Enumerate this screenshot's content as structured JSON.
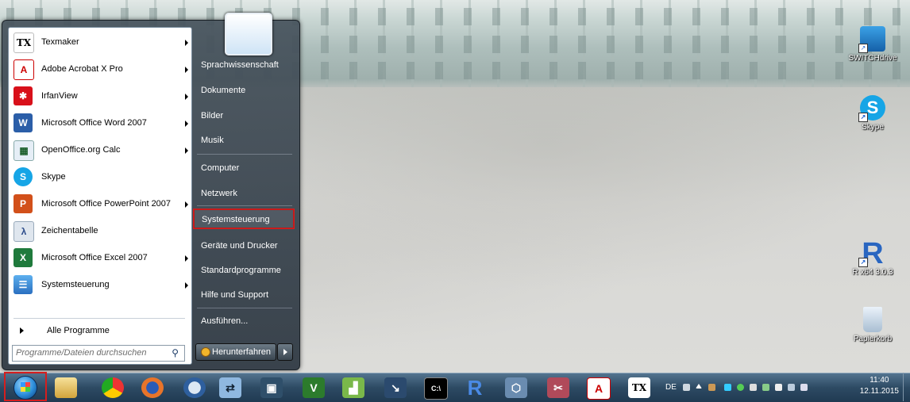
{
  "start_menu": {
    "programs": [
      {
        "label": "Texmaker",
        "icon": "texmaker-icon",
        "submenu": true
      },
      {
        "label": "Adobe Acrobat X Pro",
        "icon": "acrobat-icon",
        "submenu": true
      },
      {
        "label": "IrfanView",
        "icon": "irfanview-icon",
        "submenu": true
      },
      {
        "label": "Microsoft Office Word 2007",
        "icon": "word-icon",
        "submenu": true
      },
      {
        "label": "OpenOffice.org Calc",
        "icon": "calc-icon",
        "submenu": true
      },
      {
        "label": "Skype",
        "icon": "skype-icon",
        "submenu": false
      },
      {
        "label": "Microsoft Office PowerPoint 2007",
        "icon": "powerpoint-icon",
        "submenu": true
      },
      {
        "label": "Zeichentabelle",
        "icon": "charmap-icon",
        "submenu": false
      },
      {
        "label": "Microsoft Office Excel 2007",
        "icon": "excel-icon",
        "submenu": true
      },
      {
        "label": "Systemsteuerung",
        "icon": "control-panel-icon",
        "submenu": true
      }
    ],
    "all_programs": "Alle Programme",
    "search_placeholder": "Programme/Dateien durchsuchen",
    "right_links": [
      {
        "label": "Sprachwissenschaft"
      },
      {
        "label": "Dokumente"
      },
      {
        "label": "Bilder"
      },
      {
        "label": "Musik"
      },
      {
        "label": "Computer"
      },
      {
        "label": "Netzwerk"
      },
      {
        "label": "Systemsteuerung",
        "highlighted": true
      },
      {
        "label": "Geräte und Drucker"
      },
      {
        "label": "Standardprogramme"
      },
      {
        "label": "Hilfe und Support"
      },
      {
        "label": "Ausführen..."
      }
    ],
    "shutdown_label": "Herunterfahren"
  },
  "desktop_icons": [
    {
      "label": "SWITCHdrive",
      "icon": "switchdrive-icon"
    },
    {
      "label": "Skype",
      "icon": "skype-icon"
    },
    {
      "label": "R x64 3.0.3",
      "icon": "r-icon"
    },
    {
      "label": "Papierkorb",
      "icon": "recycle-bin-icon"
    }
  ],
  "taskbar": {
    "pinned": [
      "explorer-icon",
      "chrome-icon",
      "firefox-icon",
      "thunderbird-icon",
      "network-icon",
      "virtual-desktop-icon",
      "vim-icon",
      "chart-app-icon",
      "inkscape-icon",
      "terminal-icon",
      "r-icon",
      "virtualbox-icon",
      "tools-icon",
      "acrobat-icon",
      "texmaker-icon"
    ],
    "tray_language": "DE",
    "clock_time": "11:40",
    "clock_date": "12.11.2015"
  },
  "colors": {
    "highlight_border": "#d51e1e",
    "taskbar": "#2d4a63",
    "start_menu": "#3c4a56"
  }
}
